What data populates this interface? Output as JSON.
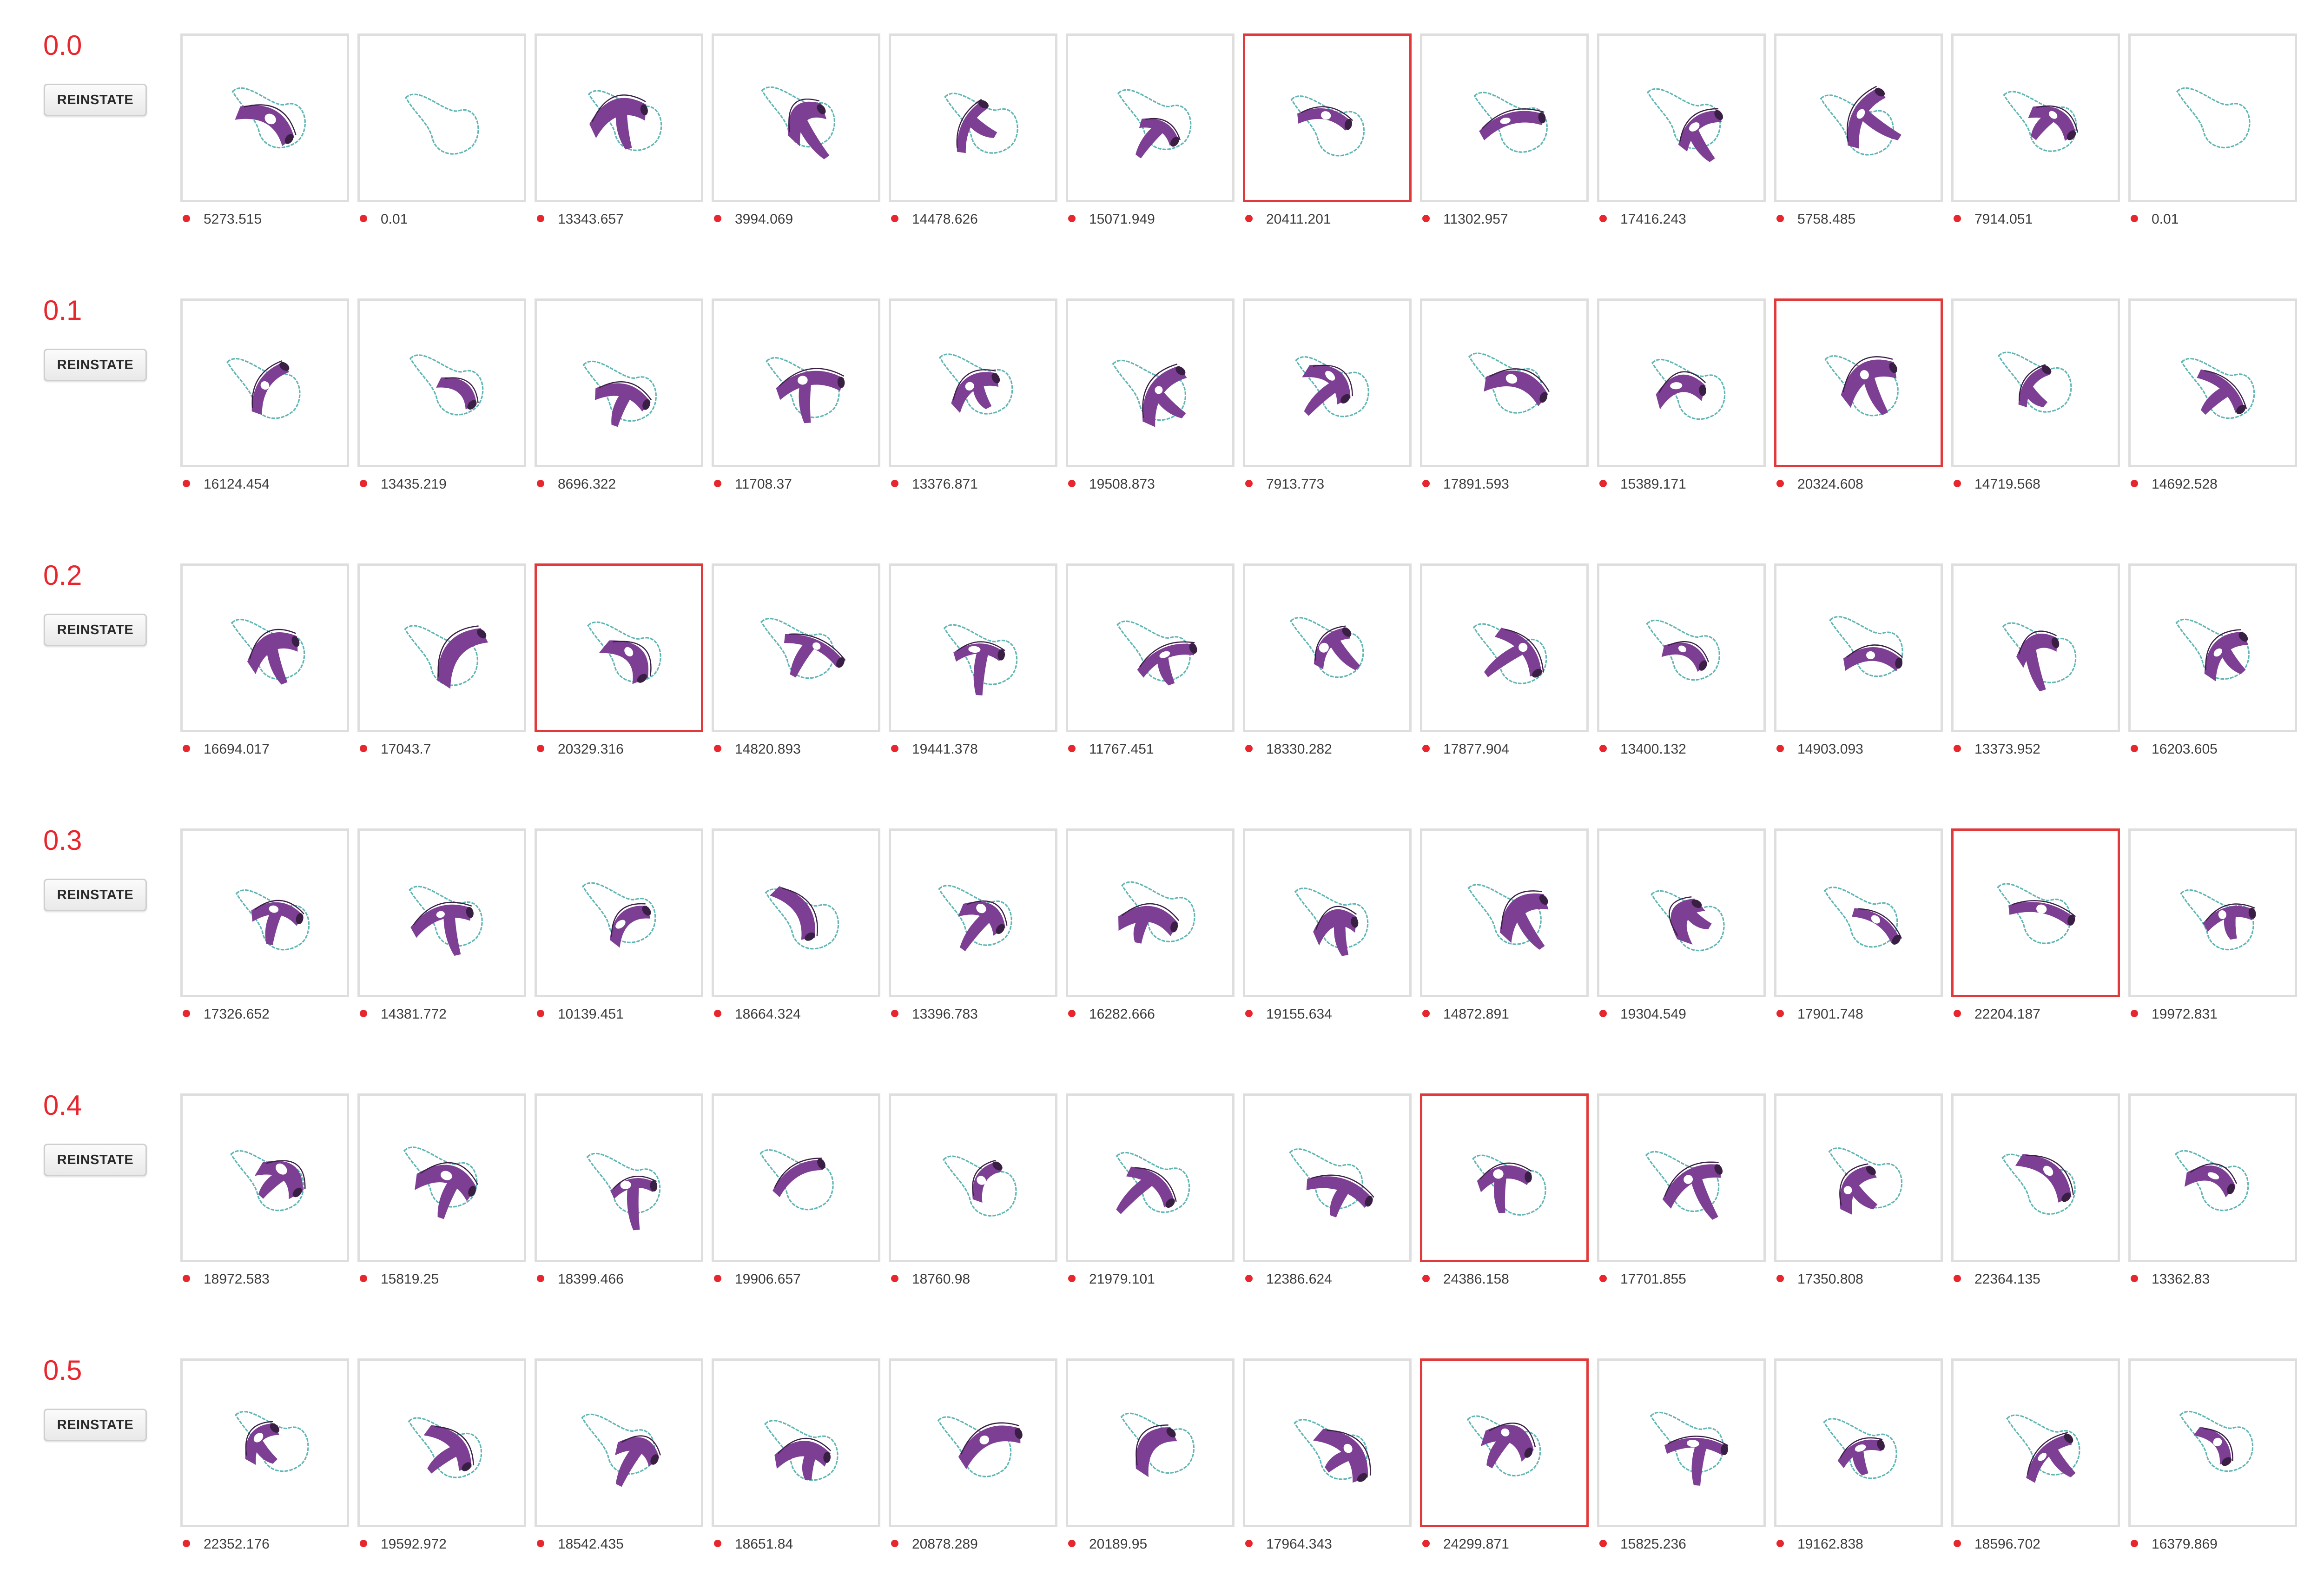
{
  "reinstate_label": "REINSTATE",
  "colors": {
    "accent": "#e8262d",
    "shape": "#7d3f93",
    "shape_dark": "#3a1f45",
    "curve": "#5fb6b3",
    "thumb_border": "#dedede",
    "selected_border": "#e23a3a"
  },
  "icons": {
    "score_marker": "red-dot-icon",
    "thumbnail": "design-preview-icon"
  },
  "generations": [
    {
      "label": "0.0",
      "selected_index": 6,
      "scores": [
        "5273.515",
        "0.01",
        "13343.657",
        "3994.069",
        "14478.626",
        "15071.949",
        "20411.201",
        "11302.957",
        "17416.243",
        "5758.485",
        "7914.051",
        "0.01"
      ]
    },
    {
      "label": "0.1",
      "selected_index": 9,
      "scores": [
        "16124.454",
        "13435.219",
        "8696.322",
        "11708.37",
        "13376.871",
        "19508.873",
        "7913.773",
        "17891.593",
        "15389.171",
        "20324.608",
        "14719.568",
        "14692.528"
      ]
    },
    {
      "label": "0.2",
      "selected_index": 2,
      "scores": [
        "16694.017",
        "17043.7",
        "20329.316",
        "14820.893",
        "19441.378",
        "11767.451",
        "18330.282",
        "17877.904",
        "13400.132",
        "14903.093",
        "13373.952",
        "16203.605"
      ]
    },
    {
      "label": "0.3",
      "selected_index": 10,
      "scores": [
        "17326.652",
        "14381.772",
        "10139.451",
        "18664.324",
        "13396.783",
        "16282.666",
        "19155.634",
        "14872.891",
        "19304.549",
        "17901.748",
        "22204.187",
        "19972.831"
      ]
    },
    {
      "label": "0.4",
      "selected_index": 7,
      "scores": [
        "18972.583",
        "15819.25",
        "18399.466",
        "19906.657",
        "18760.98",
        "21979.101",
        "12386.624",
        "24386.158",
        "17701.855",
        "17350.808",
        "22364.135",
        "13362.83"
      ]
    },
    {
      "label": "0.5",
      "selected_index": 7,
      "scores": [
        "22352.176",
        "19592.972",
        "18542.435",
        "18651.84",
        "20878.289",
        "20189.95",
        "17964.343",
        "24299.871",
        "15825.236",
        "19162.838",
        "18596.702",
        "16379.869"
      ]
    }
  ]
}
